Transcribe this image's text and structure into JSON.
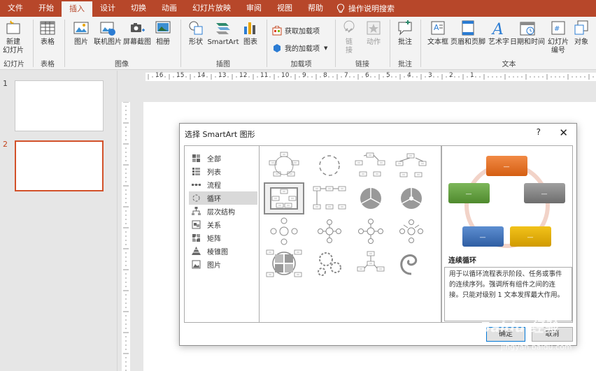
{
  "tabs": [
    "文件",
    "开始",
    "插入",
    "设计",
    "切换",
    "动画",
    "幻灯片放映",
    "审阅",
    "视图",
    "帮助"
  ],
  "tab_search": "操作说明搜索",
  "ribbon": {
    "new_slide": "新建\n幻灯片",
    "g_slides": "幻灯片",
    "table": "表格",
    "g_table": "表格",
    "picture": "图片",
    "online_picture": "联机图片",
    "screenshot": "屏幕截图",
    "album": "相册",
    "g_images": "图像",
    "shapes": "形状",
    "smartart": "SmartArt",
    "chart": "图表",
    "g_illustrations": "插图",
    "get_addins": "获取加载项",
    "my_addins": "我的加载项",
    "g_addins": "加载项",
    "link": "链\n接",
    "action": "动作",
    "g_links": "链接",
    "comment": "批注",
    "g_comments": "批注",
    "textbox": "文本框",
    "header_footer": "页眉和页脚",
    "wordart": "艺术字",
    "datetime": "日期和时间",
    "slide_number": "幻灯片\n编号",
    "object": "对象",
    "g_text": "文本"
  },
  "ruler_labels": [
    "16",
    "15",
    "14",
    "13",
    "12",
    "11",
    "10",
    "9",
    "8",
    "7",
    "6",
    "5",
    "4",
    "3",
    "2",
    "1"
  ],
  "slides": [
    "1",
    "2"
  ],
  "dialog": {
    "title": "选择 SmartArt 图形",
    "help": "?",
    "close": "✕",
    "categories": [
      "全部",
      "列表",
      "流程",
      "循环",
      "层次结构",
      "关系",
      "矩阵",
      "棱锥图",
      "图片"
    ],
    "selected_category": "循环",
    "preview_name": "连续循环",
    "preview_desc": "用于以循环流程表示阶段、任务或事件的连续序列。强调所有组件之间的连接。只能对级别 1 文本发挥最大作用。",
    "preview_box_text": "—",
    "ok": "确定",
    "cancel": "取消"
  },
  "watermark": {
    "brand": "Baidu 经验",
    "url": "jingyan.baidu.com"
  },
  "colors": {
    "accent": "#b7472a",
    "orange": "#e36c1a",
    "green": "#5f9f3c",
    "gray": "#7f7f7f",
    "blue": "#3a6fb6",
    "gold": "#e2a800",
    "ring": "#f2d3c8"
  }
}
